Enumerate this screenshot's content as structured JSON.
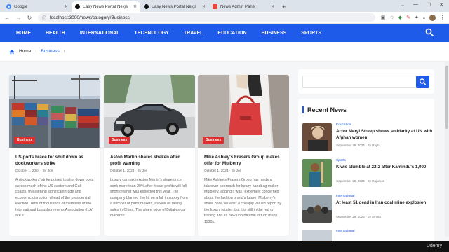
{
  "browser": {
    "tabs": [
      {
        "label": "Google",
        "favicon_color": "#4285f4"
      },
      {
        "label": "Easy News Portal Nexjs",
        "favicon_color": "#111111"
      },
      {
        "label": "Easy News Portal Nexjs",
        "favicon_color": "#111111"
      },
      {
        "label": "News Admin Panel",
        "favicon_color": "#e8453c"
      }
    ],
    "active_tab": 1,
    "new_tab": "+",
    "url": "localhost:3000/news/category/Business"
  },
  "site_nav": {
    "items": [
      "HOME",
      "HEALTH",
      "INTERNATIONAL",
      "TECHNOLOGY",
      "TRAVEL",
      "EDUCATION",
      "BUSINESS",
      "SPORTS"
    ],
    "color": "#1e5be8"
  },
  "breadcrumb": {
    "home": "Home",
    "current": "Business"
  },
  "articles": [
    {
      "category": "Business",
      "title": "US ports brace for shut down as dockworkers strike",
      "meta": "October 1, 2024 · By Jon",
      "excerpt": "A dockworkers' strike poised to shut down ports across much of the US eastern and Gulf coasts, threatening significant trade and economic disruption ahead of the presidential election. Tens of thousands of members of the International Longshoremen's Association (ILA) are s"
    },
    {
      "category": "Business",
      "title": "Aston Martin shares shaken after profit warning",
      "meta": "October 1, 2024 · By Jon",
      "excerpt": "Luxury carmaker Aston Martin's share price sank more than 20% after it said profits will fall short of what was expected this year. The company blamed the hit on a fall in supply from a number of parts makers, as well as falling sales in China. The share price of Britain's car maker th"
    },
    {
      "category": "Business",
      "title": "Mike Ashley's Frasers Group makes offer for Mulberry",
      "meta": "October 1, 2024 · By Jon",
      "excerpt": "Mike Ashley's Frasers Group has made a takeover approach for luxury handbag maker Mulberry, adding it was \"extremely concerned\" about the fashion brand's future. Mulberry's share price fell after a cheaply valued report by the luxury retailer, but it is still in the red on trading and its new unprofitable in turn many 1130s."
    }
  ],
  "sidebar": {
    "recent_heading": "Recent News",
    "recent": [
      {
        "category": "Education",
        "title": "Actor Meryl Streep shows solidarity at UN with Afghan women",
        "meta": "September 29, 2024 · By Rajib"
      },
      {
        "category": "Sports",
        "title": "Kiwis stumble at 22-2 after Kamindu's 1,000",
        "meta": "September 29, 2024 · By Rajumon"
      },
      {
        "category": "International",
        "title": "At least 51 dead in Iran coal mine explosion",
        "meta": "September 29, 2024 · By Amina"
      },
      {
        "category": "International",
        "title": "",
        "meta": ""
      }
    ]
  },
  "watermark": "Udemy"
}
